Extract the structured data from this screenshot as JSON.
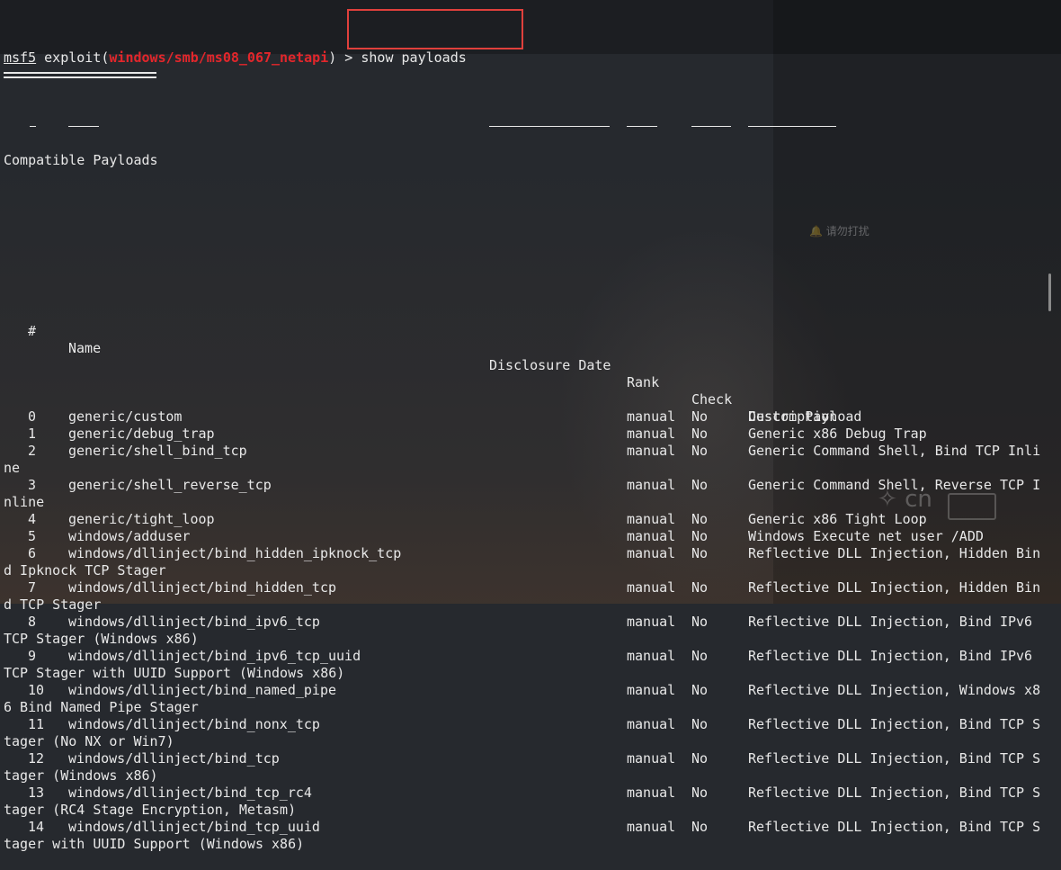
{
  "prompt": {
    "msf": "msf5",
    "exploit_word": "exploit(",
    "module": "windows/smb/ms08_067_netapi",
    "close": ") > ",
    "command": "show payloads"
  },
  "section_title": "Compatible Payloads",
  "headers": {
    "num": "#",
    "name": "Name",
    "date": "Disclosure Date",
    "rank": "Rank",
    "check": "Check",
    "description": "Description"
  },
  "rows": [
    {
      "num": "0",
      "name": "generic/custom",
      "rank": "manual",
      "check": "No",
      "desc": "Custom Payload",
      "wrap": ""
    },
    {
      "num": "1",
      "name": "generic/debug_trap",
      "rank": "manual",
      "check": "No",
      "desc": "Generic x86 Debug Trap",
      "wrap": ""
    },
    {
      "num": "2",
      "name": "generic/shell_bind_tcp",
      "rank": "manual",
      "check": "No",
      "desc": "Generic Command Shell, Bind TCP Inli",
      "wrap": "ne"
    },
    {
      "num": "3",
      "name": "generic/shell_reverse_tcp",
      "rank": "manual",
      "check": "No",
      "desc": "Generic Command Shell, Reverse TCP I",
      "wrap": "nline"
    },
    {
      "num": "4",
      "name": "generic/tight_loop",
      "rank": "manual",
      "check": "No",
      "desc": "Generic x86 Tight Loop",
      "wrap": ""
    },
    {
      "num": "5",
      "name": "windows/adduser",
      "rank": "manual",
      "check": "No",
      "desc": "Windows Execute net user /ADD",
      "wrap": ""
    },
    {
      "num": "6",
      "name": "windows/dllinject/bind_hidden_ipknock_tcp",
      "rank": "manual",
      "check": "No",
      "desc": "Reflective DLL Injection, Hidden Bin",
      "wrap": "d Ipknock TCP Stager"
    },
    {
      "num": "7",
      "name": "windows/dllinject/bind_hidden_tcp",
      "rank": "manual",
      "check": "No",
      "desc": "Reflective DLL Injection, Hidden Bin",
      "wrap": "d TCP Stager"
    },
    {
      "num": "8",
      "name": "windows/dllinject/bind_ipv6_tcp",
      "rank": "manual",
      "check": "No",
      "desc": "Reflective DLL Injection, Bind IPv6",
      "wrap": "TCP Stager (Windows x86)"
    },
    {
      "num": "9",
      "name": "windows/dllinject/bind_ipv6_tcp_uuid",
      "rank": "manual",
      "check": "No",
      "desc": "Reflective DLL Injection, Bind IPv6",
      "wrap": "TCP Stager with UUID Support (Windows x86)"
    },
    {
      "num": "10",
      "name": "windows/dllinject/bind_named_pipe",
      "rank": "manual",
      "check": "No",
      "desc": "Reflective DLL Injection, Windows x8",
      "wrap": "6 Bind Named Pipe Stager"
    },
    {
      "num": "11",
      "name": "windows/dllinject/bind_nonx_tcp",
      "rank": "manual",
      "check": "No",
      "desc": "Reflective DLL Injection, Bind TCP S",
      "wrap": "tager (No NX or Win7)"
    },
    {
      "num": "12",
      "name": "windows/dllinject/bind_tcp",
      "rank": "manual",
      "check": "No",
      "desc": "Reflective DLL Injection, Bind TCP S",
      "wrap": "tager (Windows x86)"
    },
    {
      "num": "13",
      "name": "windows/dllinject/bind_tcp_rc4",
      "rank": "manual",
      "check": "No",
      "desc": "Reflective DLL Injection, Bind TCP S",
      "wrap": "tager (RC4 Stage Encryption, Metasm)"
    },
    {
      "num": "14",
      "name": "windows/dllinject/bind_tcp_uuid",
      "rank": "manual",
      "check": "No",
      "desc": "Reflective DLL Injection, Bind TCP S",
      "wrap": "tager with UUID Support (Windows x86)"
    }
  ],
  "overlay": {
    "tooltip_text": "请勿打扰",
    "watermark_text": "cn"
  }
}
